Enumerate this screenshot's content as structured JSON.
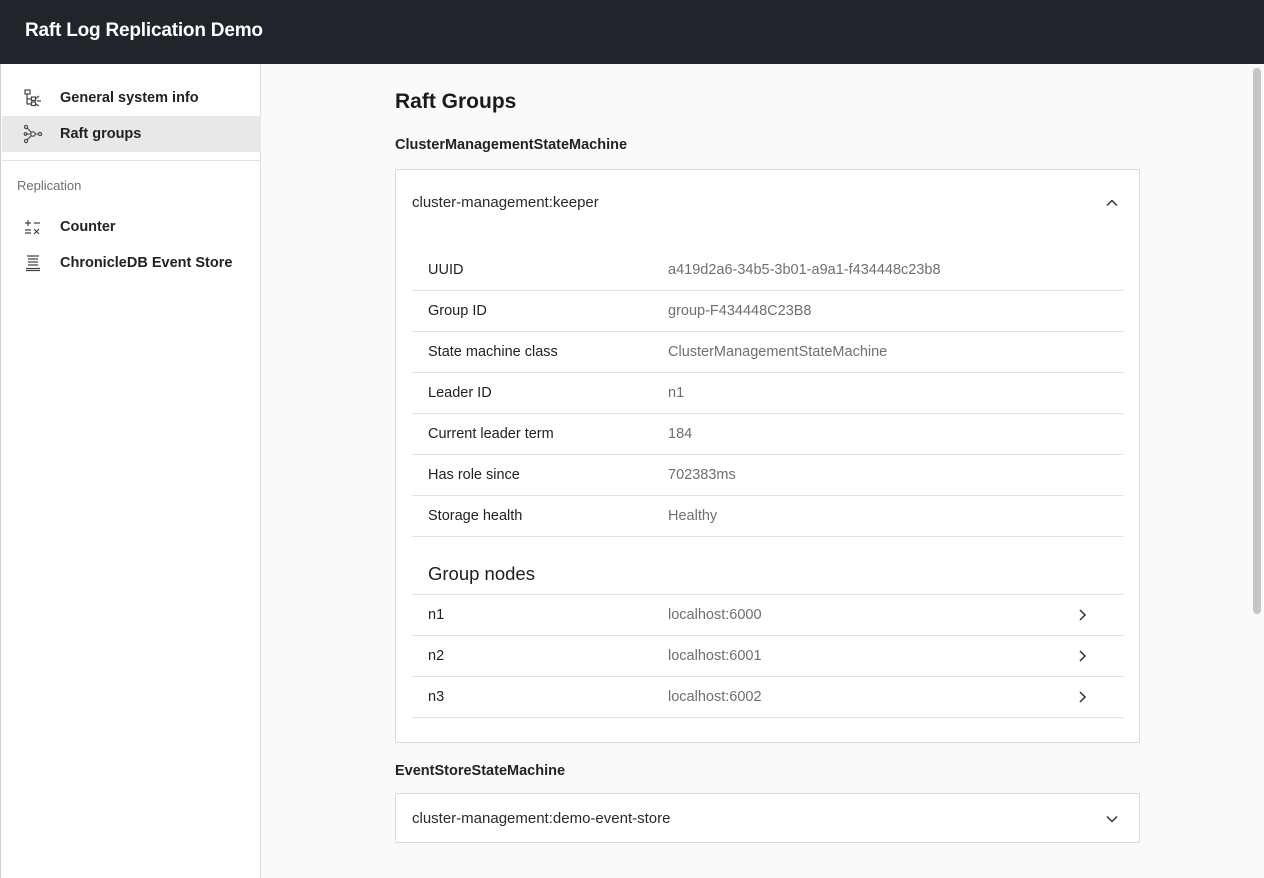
{
  "app": {
    "title": "Raft Log Replication Demo"
  },
  "sidebar": {
    "items": [
      {
        "label": "General system info",
        "icon": "system-info-icon",
        "active": false
      },
      {
        "label": "Raft groups",
        "icon": "raft-groups-icon",
        "active": true
      }
    ],
    "section_label": "Replication",
    "replication_items": [
      {
        "label": "Counter",
        "icon": "counter-icon"
      },
      {
        "label": "ChronicleDB Event Store",
        "icon": "event-store-icon"
      }
    ]
  },
  "main": {
    "title": "Raft Groups",
    "groups": [
      {
        "heading": "ClusterManagementStateMachine",
        "name": "cluster-management:keeper",
        "expanded": true,
        "details": [
          {
            "key": "UUID",
            "value": "a419d2a6-34b5-3b01-a9a1-f434448c23b8"
          },
          {
            "key": "Group ID",
            "value": "group-F434448C23B8"
          },
          {
            "key": "State machine class",
            "value": "ClusterManagementStateMachine"
          },
          {
            "key": "Leader ID",
            "value": "n1"
          },
          {
            "key": "Current leader term",
            "value": "184"
          },
          {
            "key": "Has role since",
            "value": "702383ms"
          },
          {
            "key": "Storage health",
            "value": "Healthy"
          }
        ],
        "nodes_title": "Group nodes",
        "nodes": [
          {
            "id": "n1",
            "address": "localhost:6000"
          },
          {
            "id": "n2",
            "address": "localhost:6001"
          },
          {
            "id": "n3",
            "address": "localhost:6002"
          }
        ]
      },
      {
        "heading": "EventStoreStateMachine",
        "name": "cluster-management:demo-event-store",
        "expanded": false
      }
    ]
  },
  "colors": {
    "topbar": "#21242b",
    "active_nav": "#e8e8e8",
    "muted_text": "#6f6f6f"
  }
}
